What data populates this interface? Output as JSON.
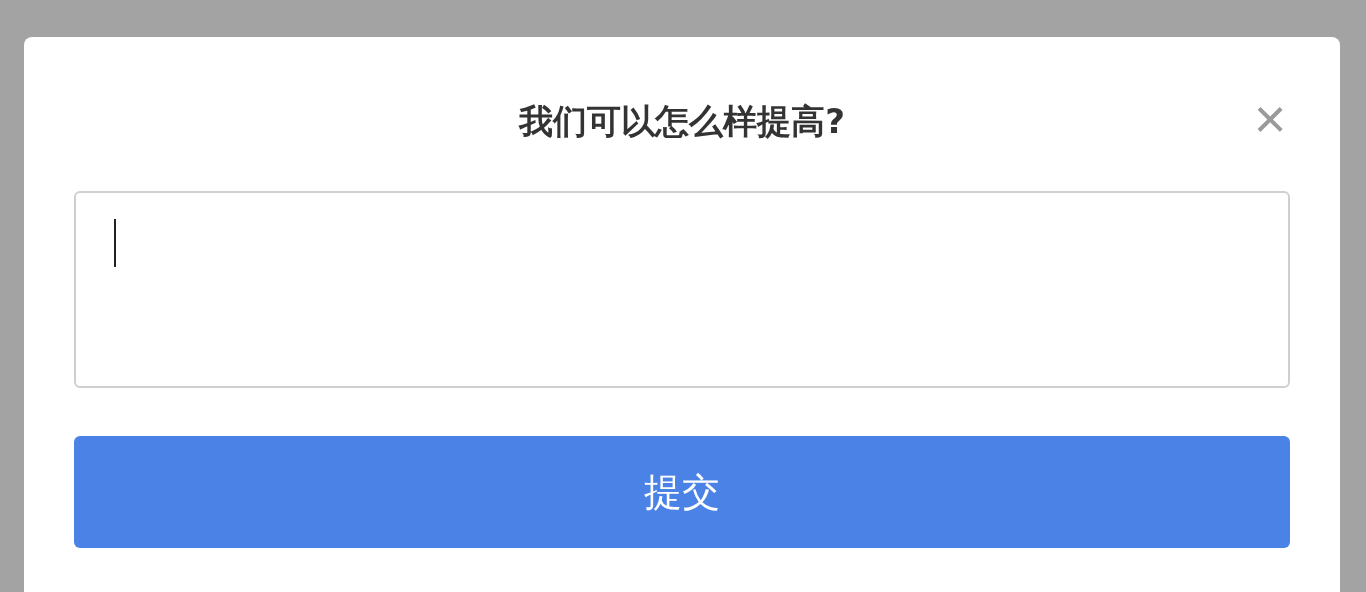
{
  "dialog": {
    "title": "我们可以怎么样提高?",
    "close_label": "×",
    "feedback_field": {
      "focused": true
    },
    "submit_button": {
      "label": "提交"
    }
  }
}
